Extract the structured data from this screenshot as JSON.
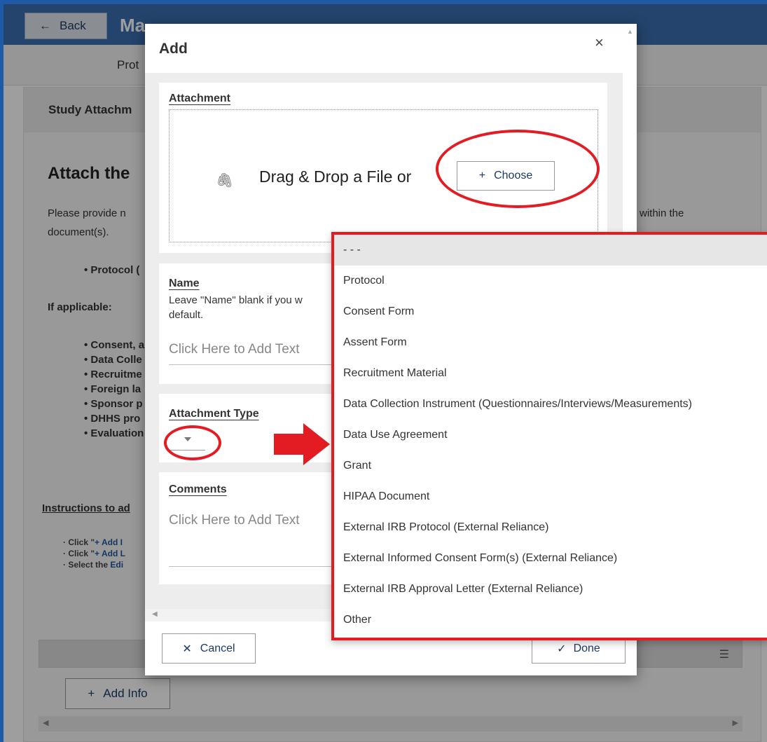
{
  "header": {
    "back_label": "Back",
    "title": "Ma"
  },
  "tab": {
    "label": "Prot"
  },
  "panel": {
    "header": "Study Attachm",
    "heading": "Attach the",
    "intro_line1": "Please provide n",
    "intro_line1_end": "within the",
    "intro_line2": "document(s).",
    "protocol_item": "• Protocol (",
    "if_applicable": "If applicable:",
    "list": [
      "• Consent, a",
      "• Data Colle",
      "• Recruitme",
      "• Foreign la",
      "• Sponsor p",
      "• DHHS pro",
      "• Evaluation"
    ],
    "instructions": "Instructions to ad",
    "sub_lines": [
      {
        "prefix": "· Click \"",
        "link": "+ Add I"
      },
      {
        "prefix": "· Click \"",
        "link": "+ Add L"
      },
      {
        "prefix": "· Select the ",
        "link": "Edi"
      }
    ],
    "add_info_label": "Add Info"
  },
  "modal": {
    "title": "Add",
    "close": "×",
    "attachment_label": "Attachment",
    "drop_text": "Drag & Drop a File or",
    "choose_label": "Choose",
    "name_label": "Name",
    "name_help": "Leave \"Name\" blank if you w default.",
    "name_placeholder": "Click Here to Add Text",
    "type_label": "Attachment Type",
    "comments_label": "Comments",
    "comments_placeholder": "Click Here to Add Text",
    "cancel_label": "Cancel",
    "done_label": "Done"
  },
  "dropdown": {
    "options": [
      "- - -",
      "Protocol",
      "Consent Form",
      "Assent Form",
      "Recruitment Material",
      "Data Collection Instrument (Questionnaires/Interviews/Measurements)",
      "Data Use Agreement",
      "Grant",
      "HIPAA Document",
      "External IRB Protocol (External Reliance)",
      "External Informed Consent Form(s) (External Reliance)",
      "External IRB Approval Letter (External Reliance)",
      "Other"
    ],
    "selected_index": 0
  },
  "colors": {
    "annotation": "#e31b23",
    "brand": "#3a6fb1"
  }
}
